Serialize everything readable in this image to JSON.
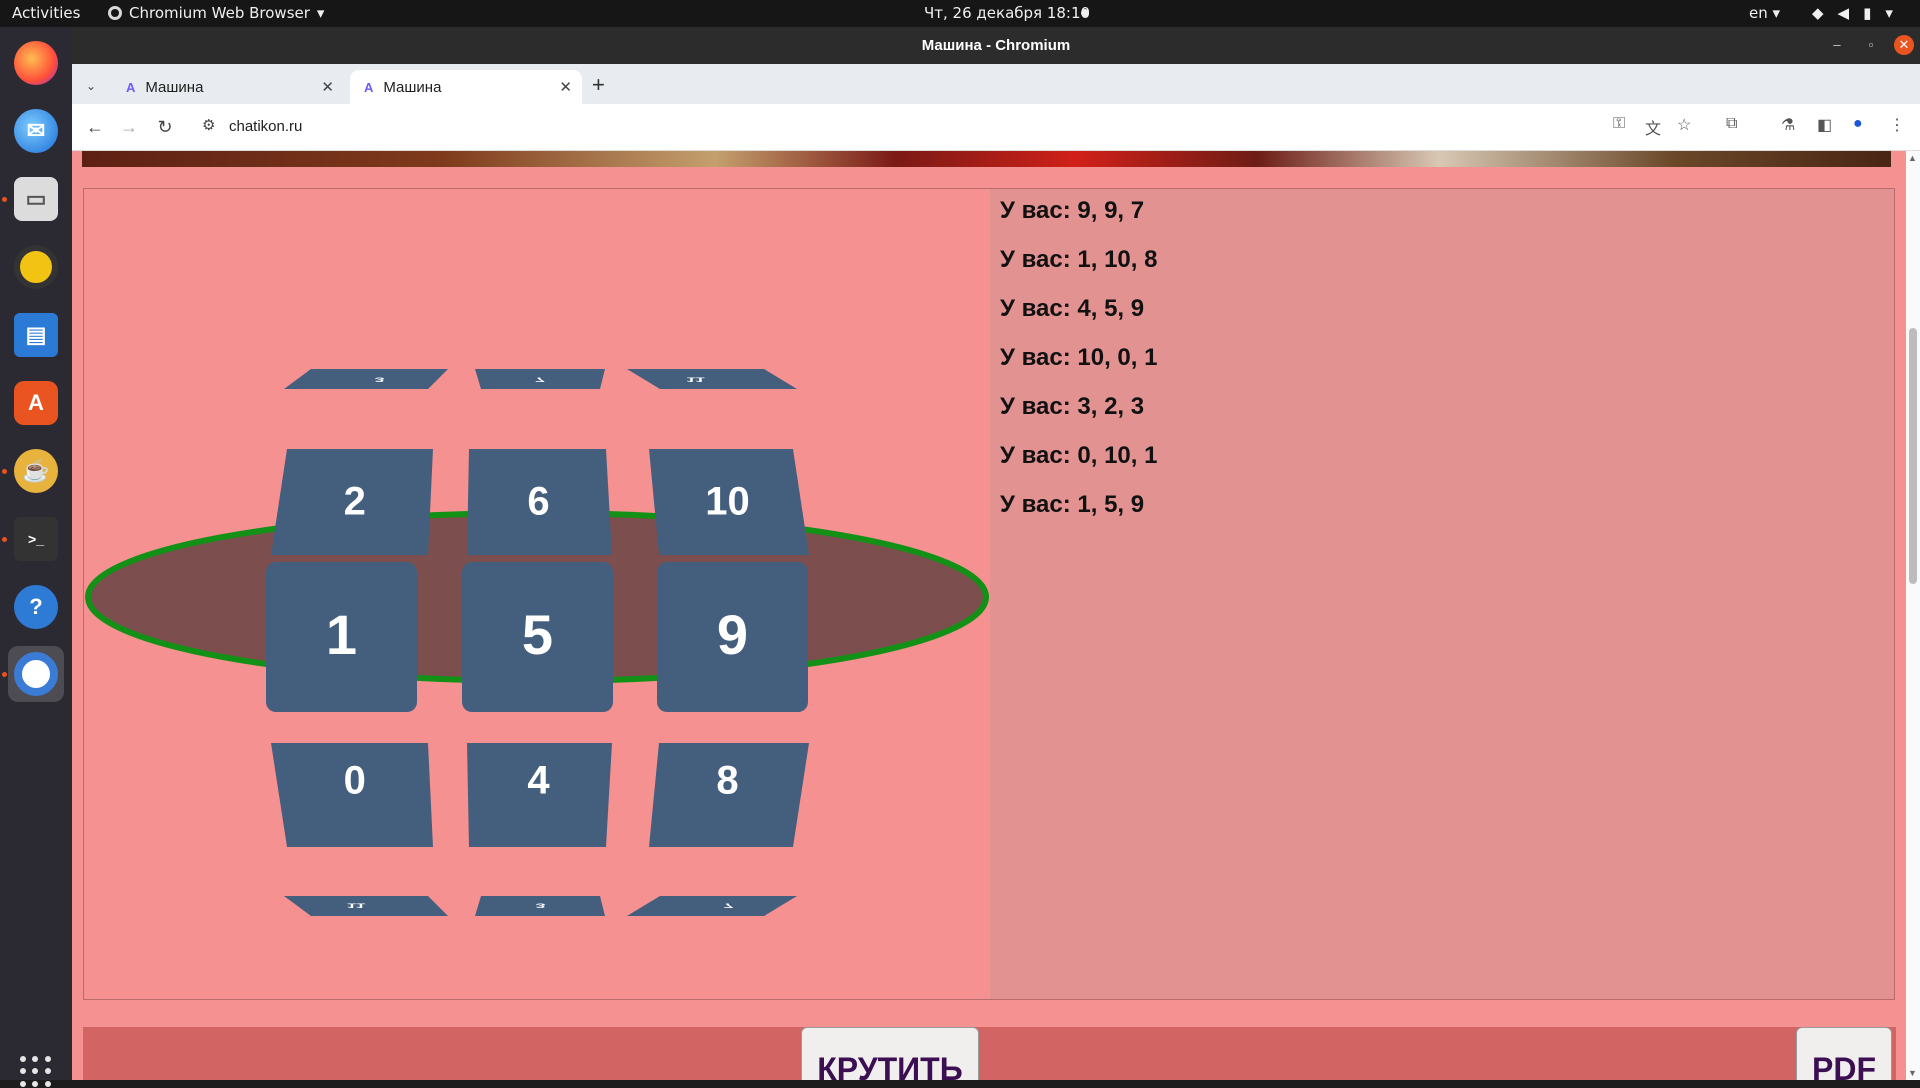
{
  "topbar": {
    "activities": "Activities",
    "app_name": "Chromium Web Browser",
    "clock": "Чт, 26 декабря  18:10",
    "lang": "en"
  },
  "window": {
    "title": "Машина - Chromium"
  },
  "tabs": [
    {
      "title": "Машина",
      "active": false
    },
    {
      "title": "Машина",
      "active": true
    }
  ],
  "address": {
    "url": "chatikon.ru"
  },
  "machine": {
    "top_small": [
      "3",
      "7",
      "11"
    ],
    "top": [
      "2",
      "6",
      "10"
    ],
    "middle": [
      "1",
      "5",
      "9"
    ],
    "bottom": [
      "0",
      "4",
      "8"
    ],
    "bottom_small": [
      "11",
      "3",
      "7"
    ],
    "colors": {
      "panel_bg": "#f59190",
      "cell": "#445f7e",
      "ring": "#139116",
      "ring_fill": "#7d4e4e"
    }
  },
  "history": [
    "У вас: 9, 9, 7",
    "У вас: 1, 10, 8",
    "У вас: 4, 5, 9",
    "У вас: 10, 0, 1",
    "У вас: 3, 2, 3",
    "У вас: 0, 10, 1",
    "У вас: 1, 5, 9"
  ],
  "buttons": {
    "spin": "КРУТИТЬ",
    "pdf": "PDF"
  }
}
